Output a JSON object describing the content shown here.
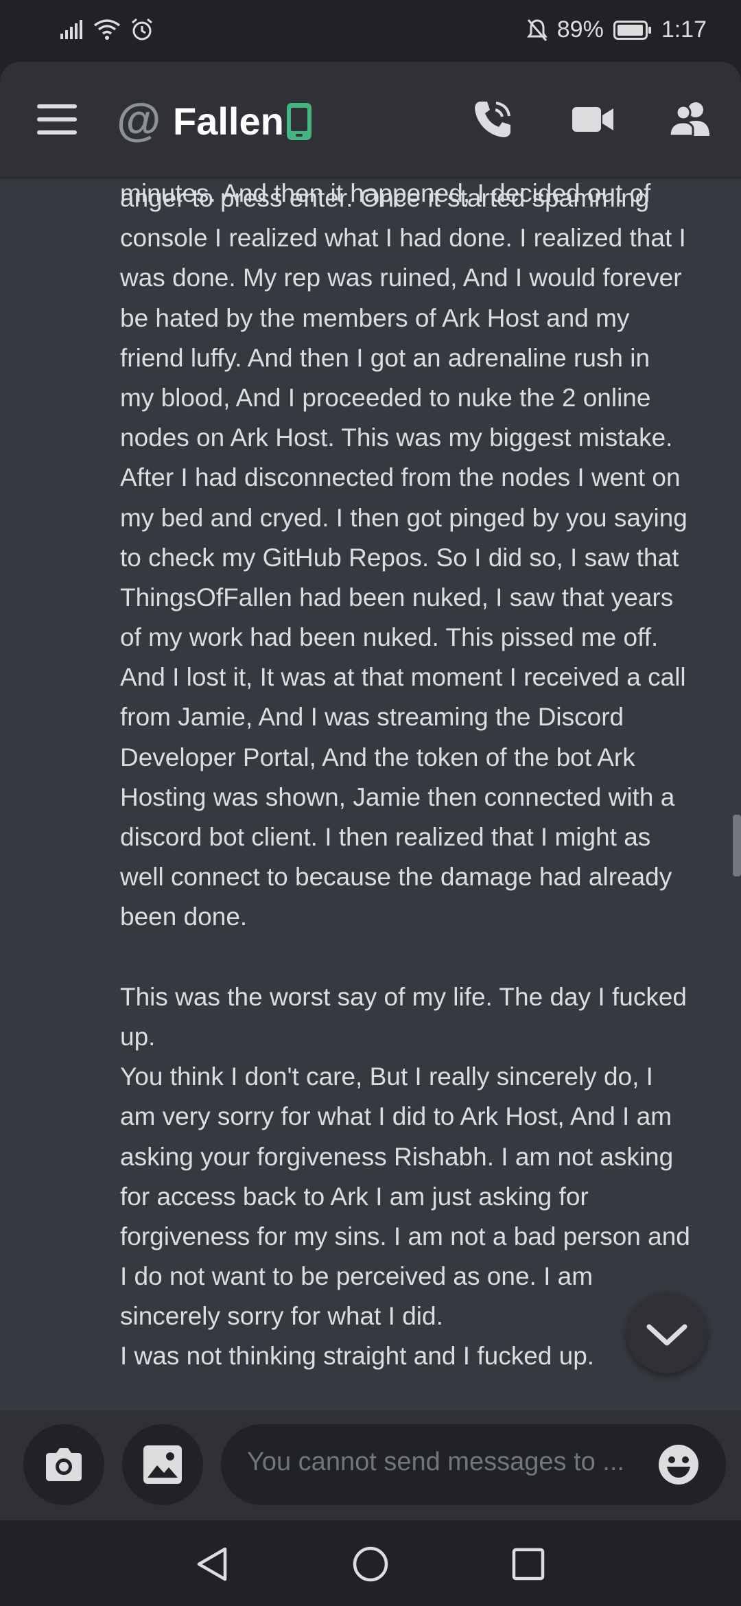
{
  "status_bar": {
    "battery": "89%",
    "time": "1:17"
  },
  "header": {
    "title": "Fallen"
  },
  "icons": {
    "menu": "hamburger-menu-icon",
    "dm": "at-sign-icon",
    "mobile": "mobile-phone-icon",
    "call": "phone-call-icon",
    "video": "video-camera-icon",
    "members": "member-list-icon",
    "jump": "chevron-down-icon",
    "camera": "camera-icon",
    "gallery": "image-icon",
    "emoji": "emoji-icon"
  },
  "colors": {
    "background": "#36393f",
    "header": "#2f3136",
    "online_mobile": "#43b581",
    "text": "#dcddde"
  },
  "message": {
    "cut_line": "minutes. And then it happened, I decided out of",
    "lines": [
      "anger to press enter. Once it started spamming",
      "console I realized what I had done. I realized that I",
      "was done. My rep was ruined, And I would forever",
      "be hated by the members of Ark Host and my",
      "friend luffy. And then I got an adrenaline rush in",
      "my blood, And I proceeded to nuke the 2 online",
      "nodes on Ark Host. This was my biggest mistake.",
      "After I had disconnected from the nodes I went on",
      "my bed and cryed. I then got pinged by you saying",
      "to check my GitHub Repos. So I did so, I saw that",
      "ThingsOfFallen had been nuked, I saw that years",
      "of my work had been nuked. This pissed me off.",
      "And I lost it, It was at that moment I received a call",
      "from Jamie, And I was streaming the Discord",
      "Developer Portal, And the token of the bot Ark",
      "Hosting was shown, Jamie then connected with a",
      "discord bot client. I then realized that I might as",
      "well connect to because the damage had already",
      "been done.",
      "",
      "This was the worst say of my life. The day I fucked",
      "up.",
      "You think I don't care, But I really sincerely do, I",
      "am very sorry for what I did to Ark Host, And I am",
      "asking your forgiveness Rishabh. I am not asking",
      "for access back to Ark I am just asking for",
      "forgiveness for my sins. I am not a bad person and",
      "I do not want to be perceived as one. I am",
      "sincerely sorry for what I did.",
      "I was not thinking straight and I fucked up."
    ]
  },
  "composer": {
    "placeholder": "You cannot send messages to ..."
  },
  "nav": {
    "back": "back-triangle-icon",
    "home": "home-circle-icon",
    "recents": "recents-square-icon"
  }
}
